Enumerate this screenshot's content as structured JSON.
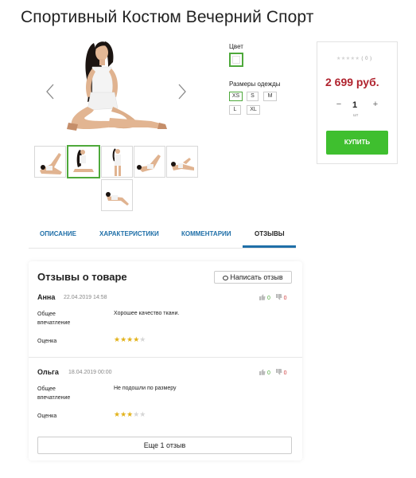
{
  "product": {
    "title": "Спортивный Костюм Вечерний Спорт"
  },
  "gallery": {
    "thumbs_count": 6,
    "active_index": 1
  },
  "options": {
    "color_label": "Цвет",
    "sizes_label": "Размеры одежды",
    "sizes": [
      "XS",
      "S",
      "M",
      "L",
      "XL"
    ],
    "selected_size": "XS"
  },
  "buy": {
    "rating_stars": "★★★★★",
    "rating_count": "( 0 )",
    "price": "2 699 руб.",
    "qty_minus": "−",
    "qty_plus": "+",
    "qty": "1",
    "unit": "шт",
    "buy_label": "Купить",
    "accent": "#3fbf2f",
    "price_color": "#b0232e"
  },
  "tabs": [
    "ОПИСАНИЕ",
    "ХАРАКТЕРИСТИКИ",
    "КОММЕНТАРИИ",
    "ОТЗЫВЫ"
  ],
  "active_tab": "ОТЗЫВЫ",
  "reviews": {
    "heading": "Отзывы о товаре",
    "write_label": "Написать отзыв",
    "impression_label": "Общее впечатление",
    "rating_label": "Оценка",
    "items": [
      {
        "author": "Анна",
        "date": "22.04.2019 14:58",
        "likes": "0",
        "dislikes": "0",
        "text": "Хорошее качество ткани.",
        "stars": 4
      },
      {
        "author": "Ольга",
        "date": "18.04.2019 00:00",
        "likes": "0",
        "dislikes": "0",
        "text": "Не подошли по размеру",
        "stars": 3
      }
    ],
    "more_label": "Еще 1 отзыв"
  }
}
